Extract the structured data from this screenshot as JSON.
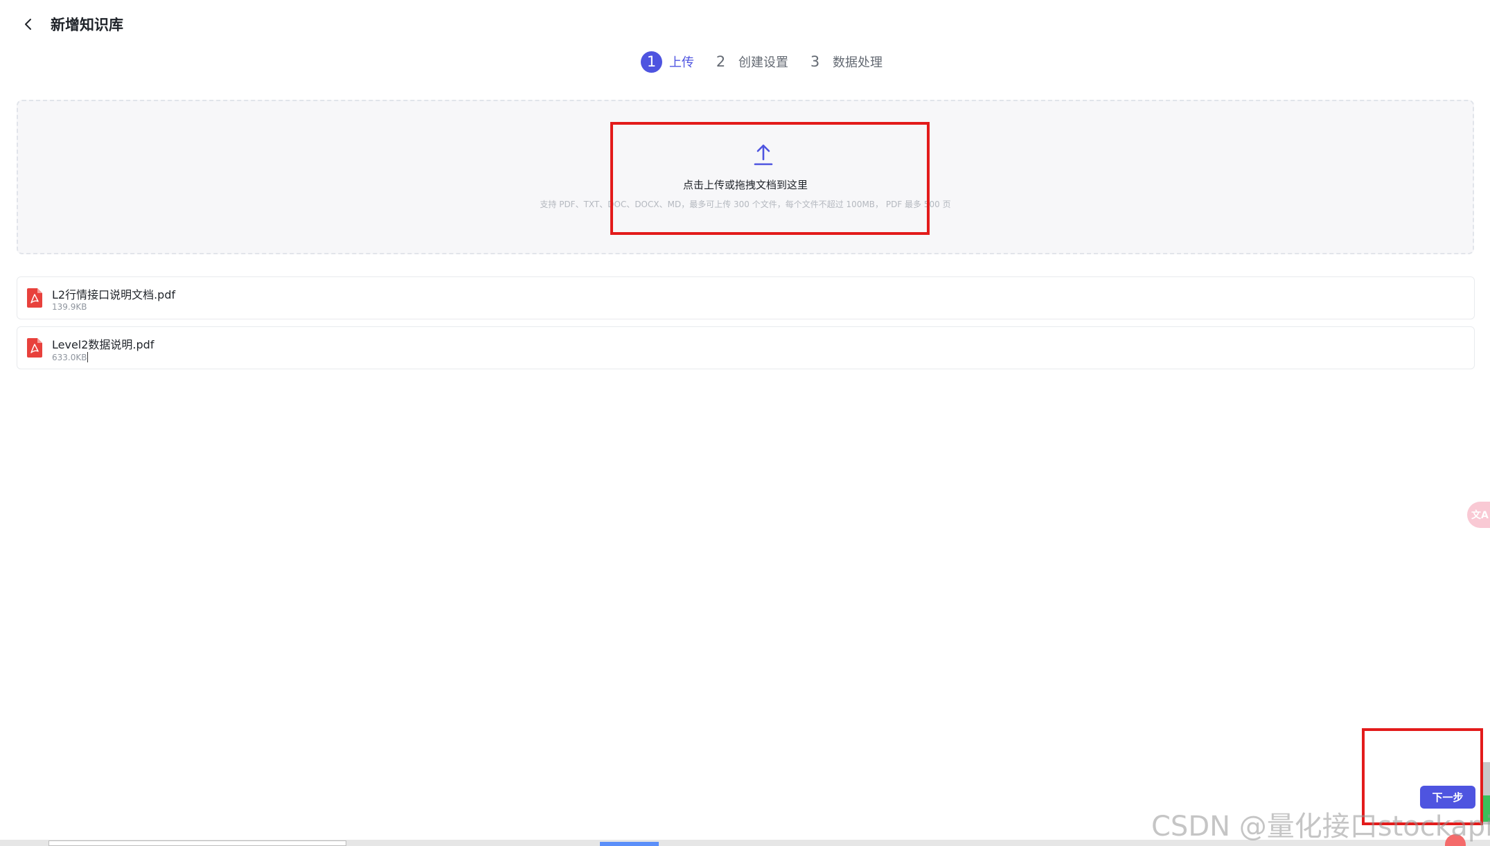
{
  "header": {
    "title": "新增知识库",
    "back_icon": "chevron-left-icon"
  },
  "steps": [
    {
      "number": "1",
      "label": "上传",
      "active": true
    },
    {
      "number": "2",
      "label": "创建设置",
      "active": false
    },
    {
      "number": "3",
      "label": "数据处理",
      "active": false
    }
  ],
  "upload": {
    "icon": "upload-icon",
    "main_text": "点击上传或拖拽文档到这里",
    "hint_text": "支持 PDF、TXT、DOC、DOCX、MD，最多可上传 300 个文件，每个文件不超过 100MB， PDF 最多 500 页"
  },
  "files": [
    {
      "name": "L2行情接口说明文档.pdf",
      "size": "139.9KB",
      "icon": "pdf-file-icon"
    },
    {
      "name": "Level2数据说明.pdf",
      "size": "633.0KB",
      "icon": "pdf-file-icon"
    }
  ],
  "side_widget": {
    "label": "文A"
  },
  "actions": {
    "next_label": "下一步"
  },
  "watermark": {
    "text": "CSDN @量化接口stockapi"
  },
  "colors": {
    "accent": "#4e54e0",
    "annotation_red": "#e31b1b",
    "pdf_red": "#e8413c",
    "upload_bg": "#f7f7f9"
  }
}
